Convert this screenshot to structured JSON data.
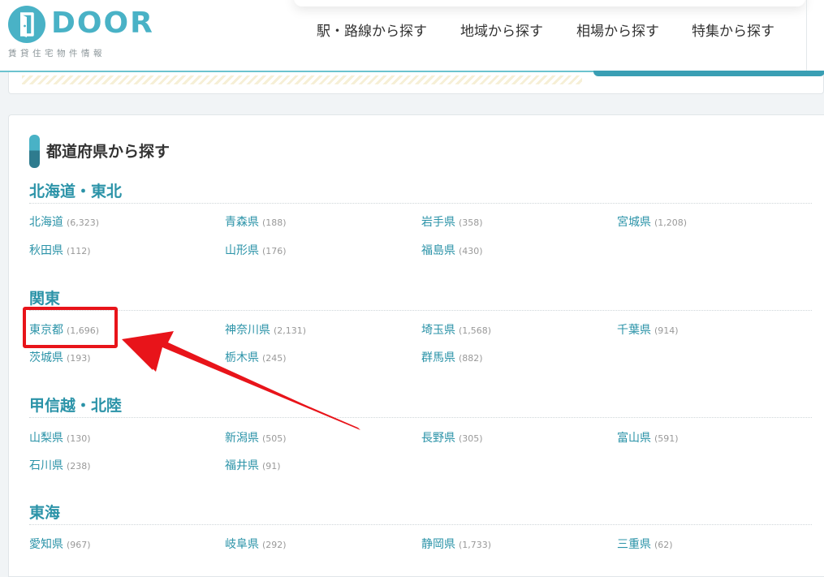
{
  "header": {
    "logo_text": "DOOR",
    "logo_subtitle": "賃貸住宅物件情報",
    "nav": [
      {
        "label": "駅・路線から探す"
      },
      {
        "label": "地域から探す"
      },
      {
        "label": "相場から探す"
      },
      {
        "label": "特集から探す"
      }
    ]
  },
  "section": {
    "title": "都道府県から探す"
  },
  "regions": [
    {
      "name": "北海道・東北",
      "prefectures": [
        {
          "name": "北海道",
          "count": "(6,323)"
        },
        {
          "name": "青森県",
          "count": "(188)"
        },
        {
          "name": "岩手県",
          "count": "(358)"
        },
        {
          "name": "宮城県",
          "count": "(1,208)"
        },
        {
          "name": "秋田県",
          "count": "(112)"
        },
        {
          "name": "山形県",
          "count": "(176)"
        },
        {
          "name": "福島県",
          "count": "(430)"
        }
      ]
    },
    {
      "name": "関東",
      "prefectures": [
        {
          "name": "東京都",
          "count": "(1,696)"
        },
        {
          "name": "神奈川県",
          "count": "(2,131)"
        },
        {
          "name": "埼玉県",
          "count": "(1,568)"
        },
        {
          "name": "千葉県",
          "count": "(914)"
        },
        {
          "name": "茨城県",
          "count": "(193)"
        },
        {
          "name": "栃木県",
          "count": "(245)"
        },
        {
          "name": "群馬県",
          "count": "(882)"
        }
      ]
    },
    {
      "name": "甲信越・北陸",
      "prefectures": [
        {
          "name": "山梨県",
          "count": "(130)"
        },
        {
          "name": "新潟県",
          "count": "(505)"
        },
        {
          "name": "長野県",
          "count": "(305)"
        },
        {
          "name": "富山県",
          "count": "(591)"
        },
        {
          "name": "石川県",
          "count": "(238)"
        },
        {
          "name": "福井県",
          "count": "(91)"
        }
      ]
    },
    {
      "name": "東海",
      "prefectures": [
        {
          "name": "愛知県",
          "count": "(967)"
        },
        {
          "name": "岐阜県",
          "count": "(292)"
        },
        {
          "name": "静岡県",
          "count": "(1,733)"
        },
        {
          "name": "三重県",
          "count": "(62)"
        }
      ]
    }
  ],
  "annotation": {
    "highlighted": "東京都",
    "color": "#e8141a"
  },
  "colors": {
    "accent": "#49b2c6",
    "link": "#2b93a8",
    "count": "#999999"
  },
  "icons": {
    "logo": "door-logo-icon",
    "section_marker": "section-marker-icon",
    "annotation": "red-arrow-icon"
  }
}
